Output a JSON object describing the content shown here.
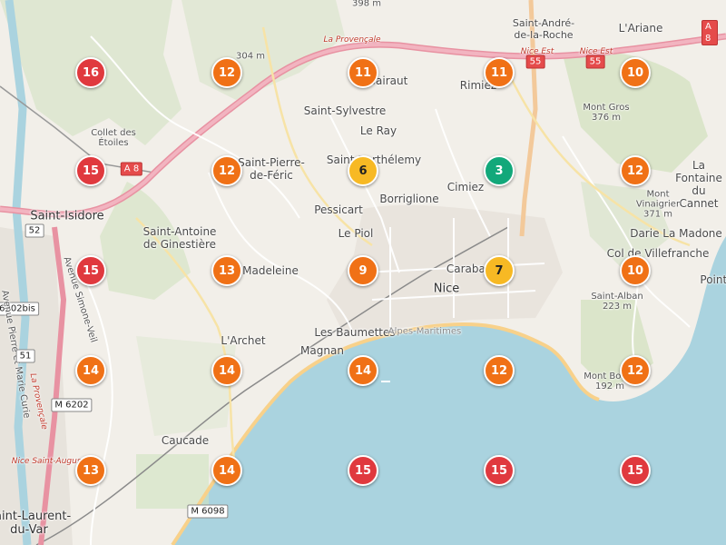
{
  "colors": {
    "red": "#e0393e",
    "orange": "#f07116",
    "yellow": "#f7b924",
    "green": "#12a87a",
    "sea": "#aad3df",
    "land": "#f2efe9"
  },
  "markers": [
    {
      "value": "16",
      "level": "red"
    },
    {
      "value": "12",
      "level": "orange"
    },
    {
      "value": "11",
      "level": "orange"
    },
    {
      "value": "11",
      "level": "orange"
    },
    {
      "value": "10",
      "level": "orange"
    },
    {
      "value": "15",
      "level": "red"
    },
    {
      "value": "12",
      "level": "orange"
    },
    {
      "value": "6",
      "level": "yellow"
    },
    {
      "value": "3",
      "level": "green"
    },
    {
      "value": "12",
      "level": "orange"
    },
    {
      "value": "15",
      "level": "red"
    },
    {
      "value": "13",
      "level": "orange"
    },
    {
      "value": "9",
      "level": "orange"
    },
    {
      "value": "7",
      "level": "yellow"
    },
    {
      "value": "10",
      "level": "orange"
    },
    {
      "value": "14",
      "level": "orange"
    },
    {
      "value": "14",
      "level": "orange"
    },
    {
      "value": "14",
      "level": "orange"
    },
    {
      "value": "12",
      "level": "orange"
    },
    {
      "value": "12",
      "level": "orange"
    },
    {
      "value": "13",
      "level": "orange"
    },
    {
      "value": "14",
      "level": "orange"
    },
    {
      "value": "15",
      "level": "red"
    },
    {
      "value": "15",
      "level": "red"
    },
    {
      "value": "15",
      "level": "red"
    }
  ],
  "places": {
    "saint_andre": "Saint-André-\nde-la-Roche",
    "lariane": "L'Ariane",
    "la_provencale": "La Provençale",
    "nice_est": "Nice Est",
    "nice_est_num": "55",
    "a8_right": "A 8",
    "elev_304": "304 m",
    "elev_398": "398 m",
    "elev_376": "Mont Gros\n376 m",
    "saint_sylvestre": "Saint-Sylvestre",
    "le_ray": "Le Ray",
    "rimiez": "Rimiez",
    "gairaut": "Gairaut",
    "collet": "Collet des\nÉtoiles",
    "a8_left": "A 8",
    "saint_pierre": "Saint-Pierre-\nde-Féric",
    "saint_barthelemy": "Saint-Barthélemy",
    "borriglione": "Borriglione",
    "cimiez": "Cimiez",
    "la_fontaine": "La Fontaine\ndu Cannet",
    "saint_isidore": "Saint-Isidore",
    "pessicart": "Pessicart",
    "mont_vinaigrier": "Mont Vinaigrier\n371 m",
    "saint_antoine": "Saint-Antoine\nde Ginestière",
    "le_piol": "Le Piol",
    "darie": "Darie La Madone",
    "route_6202bis": "6202bis",
    "avenue_simone": "Avenue Simone-Veil",
    "madeleine": "Madeleine",
    "carabacel": "Carabacel",
    "col_de_villefranche": "Col de Villefranche",
    "pointe": "Pointe",
    "nice": "Nice",
    "saint_alban": "Saint-Alban\n223 m",
    "avenue_pierre": "Avenue Pierre et Marie Curie",
    "larchet": "L'Archet",
    "les_baumettes": "Les Baumettes",
    "magnan": "Magnan",
    "alpes_maritimes": "Alpes-Maritimes",
    "mont_boron": "Mont Boron\n192 m",
    "m6202": "M 6202",
    "la_provencale_v": "La Provençale",
    "caucade": "Caucade",
    "nice_saint_augustin": "Nice Saint-Augustin",
    "m6098": "M 6098",
    "saint_laurent": "Saint-Laurent-\ndu-Var",
    "s1": "51",
    "s2": "52"
  }
}
